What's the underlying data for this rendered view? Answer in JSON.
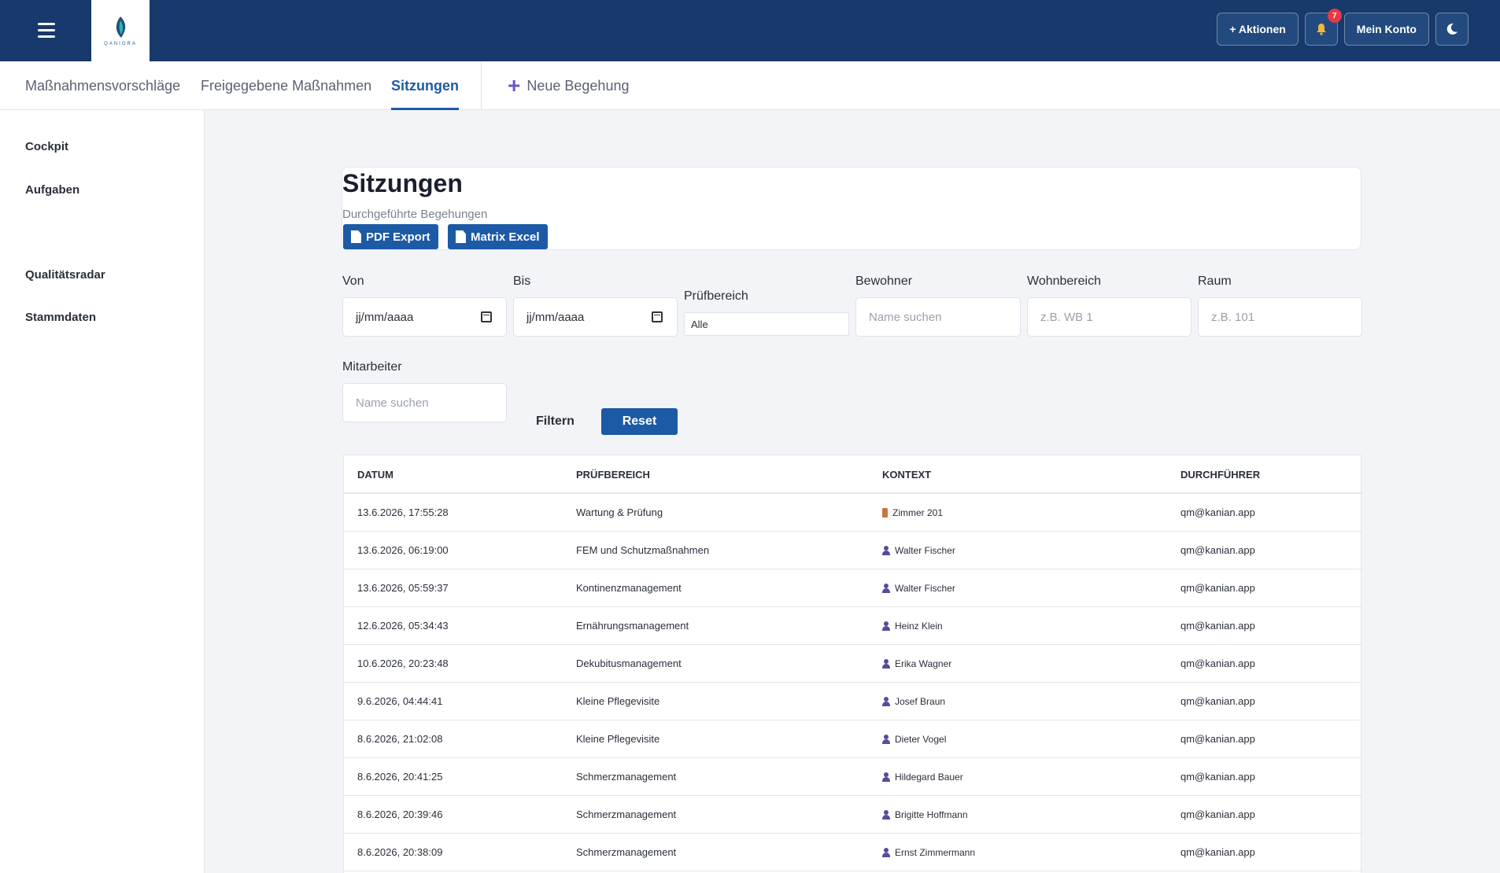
{
  "header": {
    "brand": "QANIORA",
    "actions_label": "+ Aktionen",
    "notifications_count": "7",
    "account_label": "Mein Konto"
  },
  "tabs": [
    {
      "label": "Maßnahmensvorschläge"
    },
    {
      "label": "Freigegebene Maßnahmen"
    },
    {
      "label": "Sitzungen"
    }
  ],
  "new_tab_label": "Neue Begehung",
  "sidebar": {
    "items": [
      {
        "label": "Cockpit"
      },
      {
        "label": "Aufgaben"
      },
      {
        "label": "Qualitätsradar"
      },
      {
        "label": "Stammdaten"
      }
    ]
  },
  "page": {
    "title": "Sitzungen",
    "subtitle": "Durchgeführte Begehungen",
    "pdf_export_label": "PDF Export",
    "matrix_excel_label": "Matrix Excel"
  },
  "filters": {
    "von_label": "Von",
    "von_value": "jj/mm/aaaa",
    "bis_label": "Bis",
    "bis_value": "jj/mm/aaaa",
    "pruefbereich_label": "Prüfbereich",
    "pruefbereich_value": "Alle",
    "bewohner_label": "Bewohner",
    "bewohner_placeholder": "Name suchen",
    "wohnbereich_label": "Wohnbereich",
    "wohnbereich_placeholder": "z.B. WB 1",
    "raum_label": "Raum",
    "raum_placeholder": "z.B. 101",
    "mitarbeiter_label": "Mitarbeiter",
    "mitarbeiter_placeholder": "Name suchen",
    "filter_label": "Filtern",
    "reset_label": "Reset"
  },
  "table": {
    "columns": [
      "Datum",
      "Prüfbereich",
      "Kontext",
      "Durchführer"
    ],
    "rows": [
      {
        "datum": "13.6.2026, 17:55:28",
        "bereich": "Wartung & Prüfung",
        "kontext": "Zimmer 201",
        "kontext_type": "room",
        "durchfuehrer": "qm@kanian.app"
      },
      {
        "datum": "13.6.2026, 06:19:00",
        "bereich": "FEM und Schutzmaßnahmen",
        "kontext": "Walter Fischer",
        "kontext_type": "person",
        "durchfuehrer": "qm@kanian.app"
      },
      {
        "datum": "13.6.2026, 05:59:37",
        "bereich": "Kontinenzmanagement",
        "kontext": "Walter Fischer",
        "kontext_type": "person",
        "durchfuehrer": "qm@kanian.app"
      },
      {
        "datum": "12.6.2026, 05:34:43",
        "bereich": "Ernährungsmanagement",
        "kontext": "Heinz Klein",
        "kontext_type": "person",
        "durchfuehrer": "qm@kanian.app"
      },
      {
        "datum": "10.6.2026, 20:23:48",
        "bereich": "Dekubitusmanagement",
        "kontext": "Erika Wagner",
        "kontext_type": "person",
        "durchfuehrer": "qm@kanian.app"
      },
      {
        "datum": "9.6.2026, 04:44:41",
        "bereich": "Kleine Pflegevisite",
        "kontext": "Josef Braun",
        "kontext_type": "person",
        "durchfuehrer": "qm@kanian.app"
      },
      {
        "datum": "8.6.2026, 21:02:08",
        "bereich": "Kleine Pflegevisite",
        "kontext": "Dieter Vogel",
        "kontext_type": "person",
        "durchfuehrer": "qm@kanian.app"
      },
      {
        "datum": "8.6.2026, 20:41:25",
        "bereich": "Schmerzmanagement",
        "kontext": "Hildegard Bauer",
        "kontext_type": "person",
        "durchfuehrer": "qm@kanian.app"
      },
      {
        "datum": "8.6.2026, 20:39:46",
        "bereich": "Schmerzmanagement",
        "kontext": "Brigitte Hoffmann",
        "kontext_type": "person",
        "durchfuehrer": "qm@kanian.app"
      },
      {
        "datum": "8.6.2026, 20:38:09",
        "bereich": "Schmerzmanagement",
        "kontext": "Ernst Zimmermann",
        "kontext_type": "person",
        "durchfuehrer": "qm@kanian.app"
      }
    ]
  }
}
